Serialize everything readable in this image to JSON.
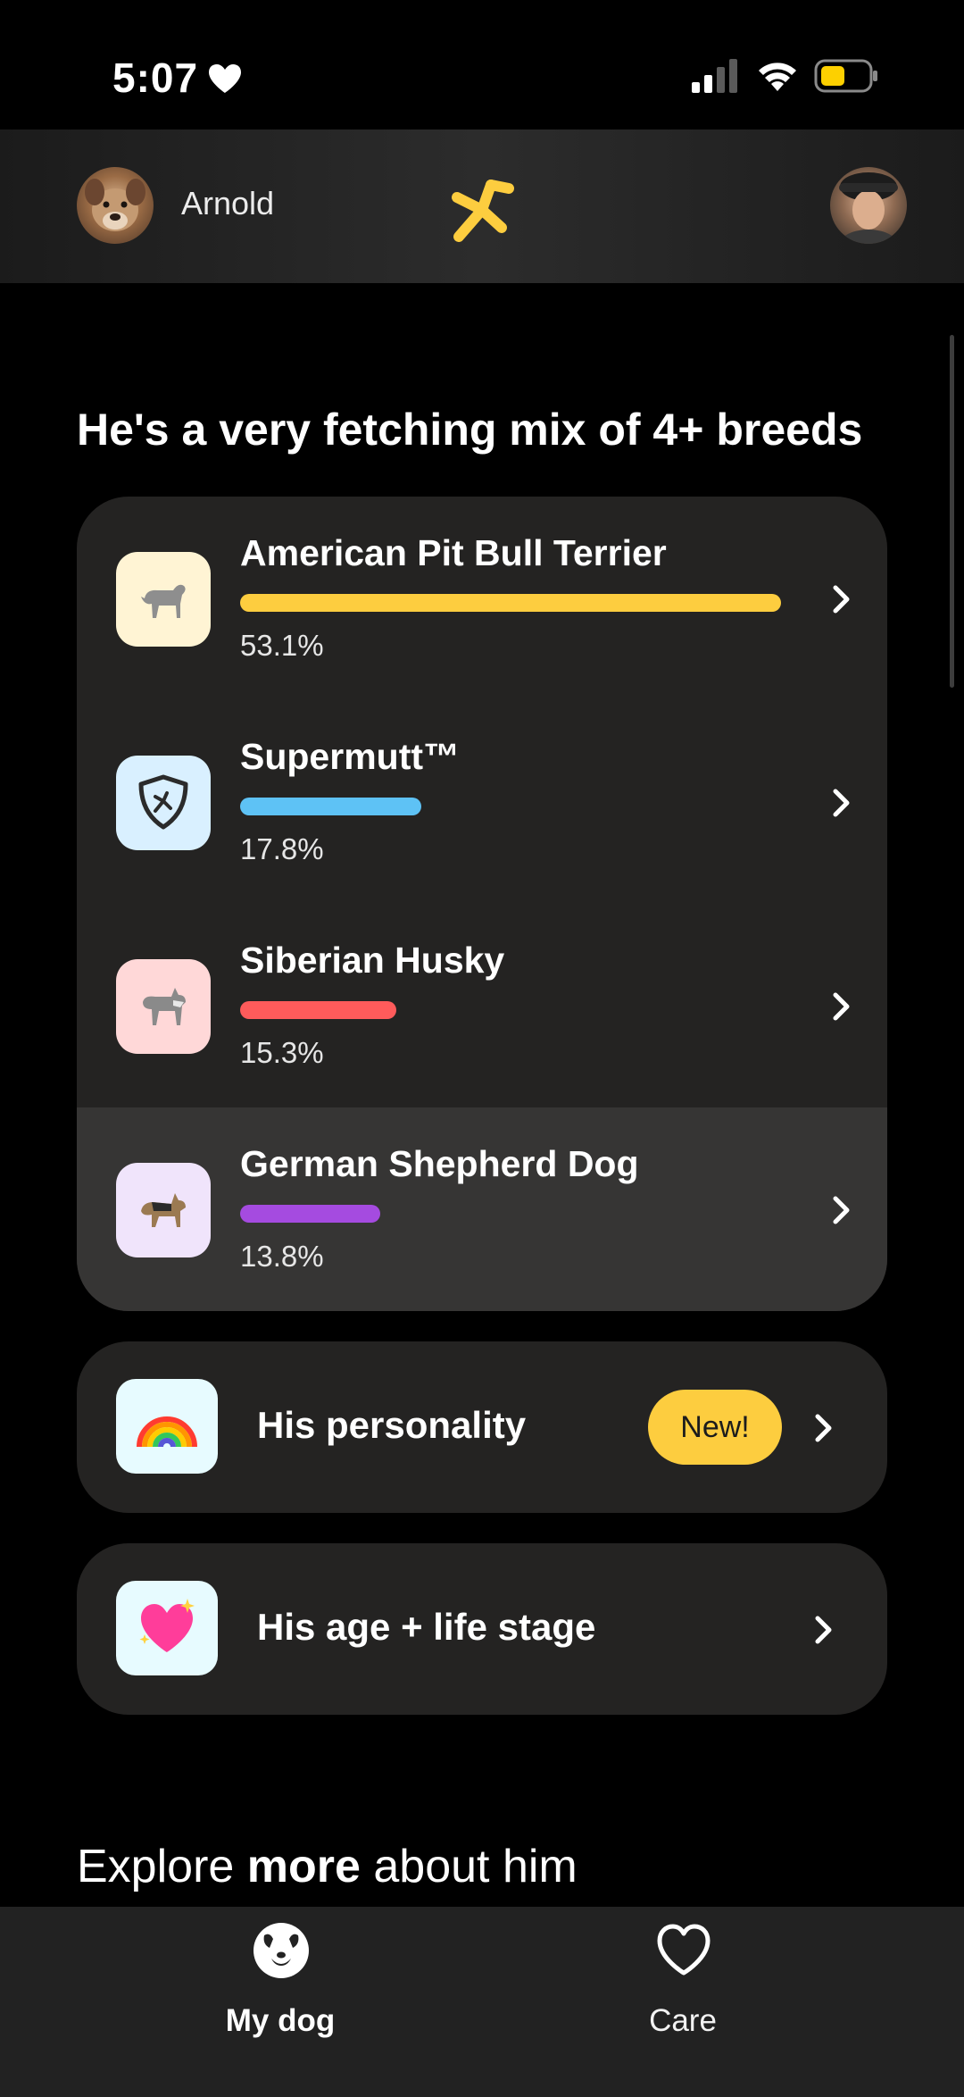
{
  "status_bar": {
    "time": "5:07"
  },
  "header": {
    "dog_name": "Arnold"
  },
  "section": {
    "title": "He's a very fetching mix of 4+ breeds"
  },
  "breeds": [
    {
      "name": "American Pit Bull Terrier",
      "percent_label": "53.1%",
      "percent": 53.1,
      "color": "#fdcd3f",
      "icon_bg": "#fff4d4",
      "icon": "pit-bull-icon"
    },
    {
      "name": "Supermutt™",
      "percent_label": "17.8%",
      "percent": 17.8,
      "color": "#5ec2f5",
      "icon_bg": "#d9f0ff",
      "icon": "shield-icon"
    },
    {
      "name": "Siberian Husky",
      "percent_label": "15.3%",
      "percent": 15.3,
      "color": "#ff5b5b",
      "icon_bg": "#ffd8d8",
      "icon": "husky-icon"
    },
    {
      "name": "German Shepherd Dog",
      "percent_label": "13.8%",
      "percent": 13.8,
      "color": "#a54be0",
      "icon_bg": "#f0e4fb",
      "icon": "german-shepherd-icon"
    }
  ],
  "cards": {
    "personality": {
      "label": "His personality",
      "badge": "New!",
      "icon": "rainbow-icon"
    },
    "age": {
      "label": "His age + life stage",
      "icon": "sparkling-heart-icon"
    }
  },
  "explore": {
    "prefix": "Explore",
    "bold": "more",
    "suffix": "about him"
  },
  "tab_bar": {
    "my_dog_label": "My dog",
    "care_label": "Care"
  },
  "colors": {
    "accent": "#fdcd3f",
    "card_bg": "#242322",
    "active_row_bg": "#363534"
  }
}
